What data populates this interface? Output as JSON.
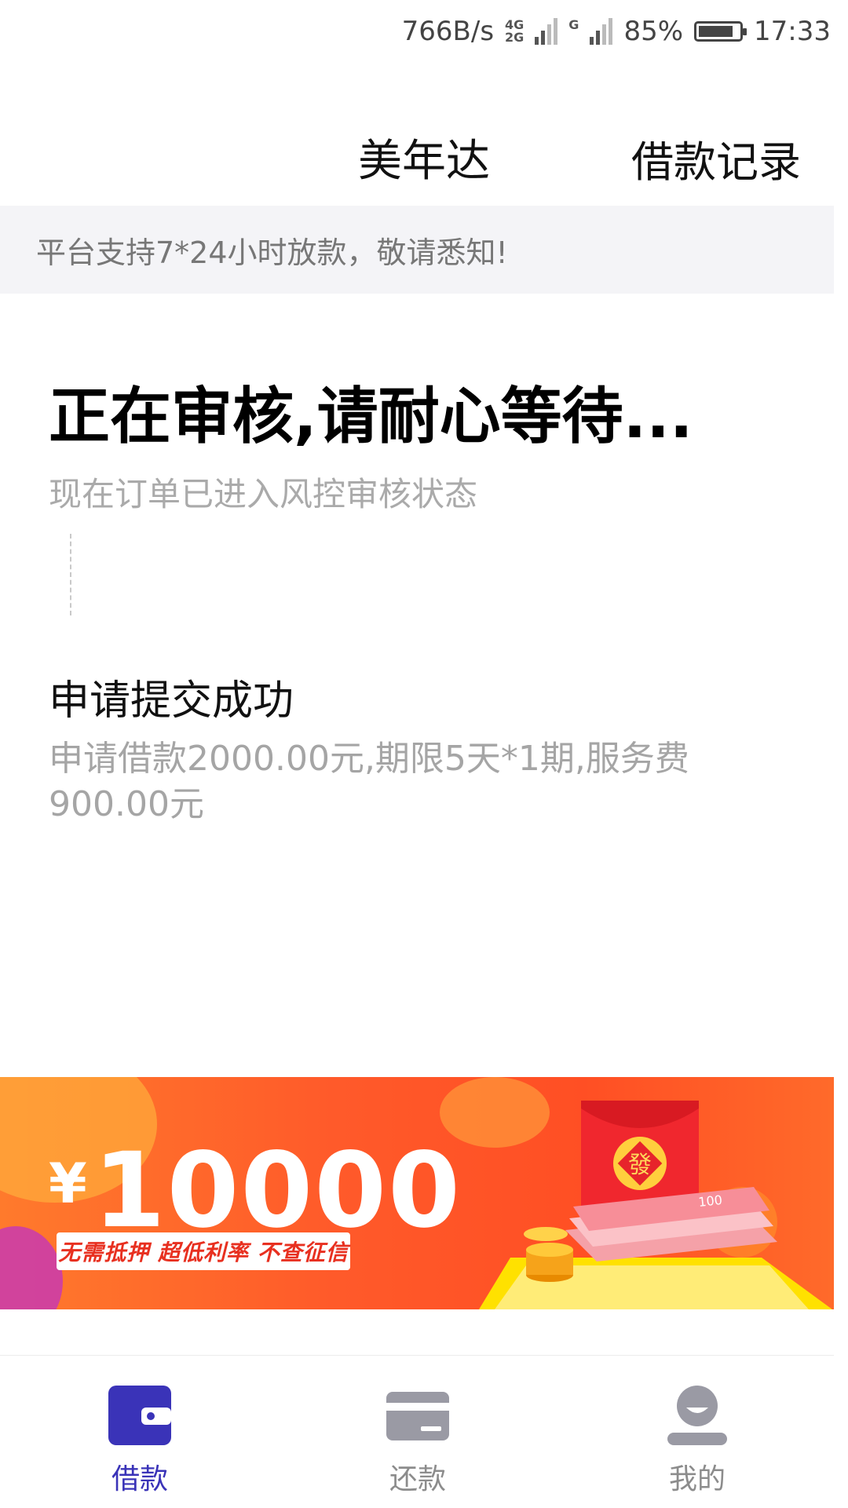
{
  "status_bar": {
    "speed": "766B/s",
    "net_top": "4G",
    "net_bottom": "2G",
    "net2": "G",
    "battery": "85%",
    "battery_level": 0.85,
    "time": "17:33"
  },
  "header": {
    "title": "美年达",
    "records_link": "借款记录"
  },
  "notice": "平台支持7*24小时放款，敬请悉知!",
  "review": {
    "title": "正在审核,请耐心等待...",
    "subtitle": "现在订单已进入风控审核状态"
  },
  "step": {
    "title": "申请提交成功",
    "description": "申请借款2000.00元,期限5天*1期,服务费900.00元"
  },
  "banner": {
    "currency": "¥",
    "amount": "10000",
    "tagline": "无需抵押  超低利率  不查征信",
    "envelope_char": "發",
    "bill_note": "100"
  },
  "tabbar": {
    "tabs": [
      {
        "label": "借款",
        "icon": "wallet-icon",
        "active": true
      },
      {
        "label": "还款",
        "icon": "card-icon",
        "active": false
      },
      {
        "label": "我的",
        "icon": "user-icon",
        "active": false
      }
    ]
  },
  "colors": {
    "accent": "#3a33b8",
    "banner": "#ff5a2a",
    "inactive": "#8c8c8c"
  }
}
